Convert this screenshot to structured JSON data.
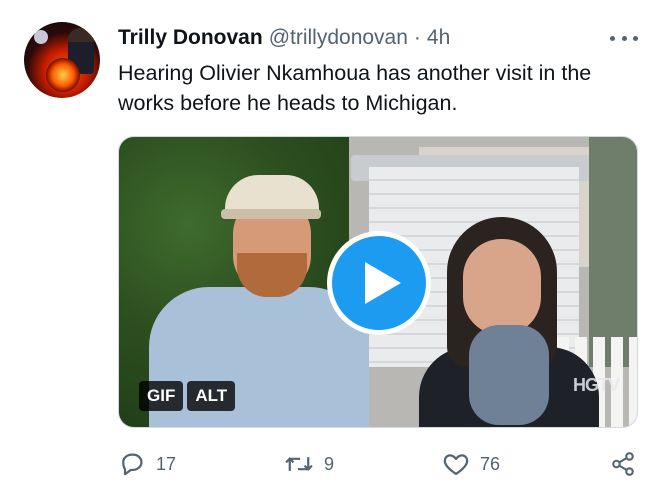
{
  "tweet": {
    "author_name": "Trilly Donovan",
    "handle": "@trillydonovan",
    "separator": "·",
    "time": "4h",
    "text": "Hearing Olivier Nkamhoua has another visit in the works before he heads to Michigan.",
    "media": {
      "badges": [
        "GIF",
        "ALT"
      ],
      "watermark": "HGTV",
      "play_icon": "play-icon"
    },
    "actions": {
      "replies": "17",
      "retweets": "9",
      "likes": "76",
      "share_icon": "share-icon"
    }
  },
  "colors": {
    "accent": "#1d9bf0",
    "text_primary": "#0f1419",
    "text_secondary": "#536471"
  }
}
